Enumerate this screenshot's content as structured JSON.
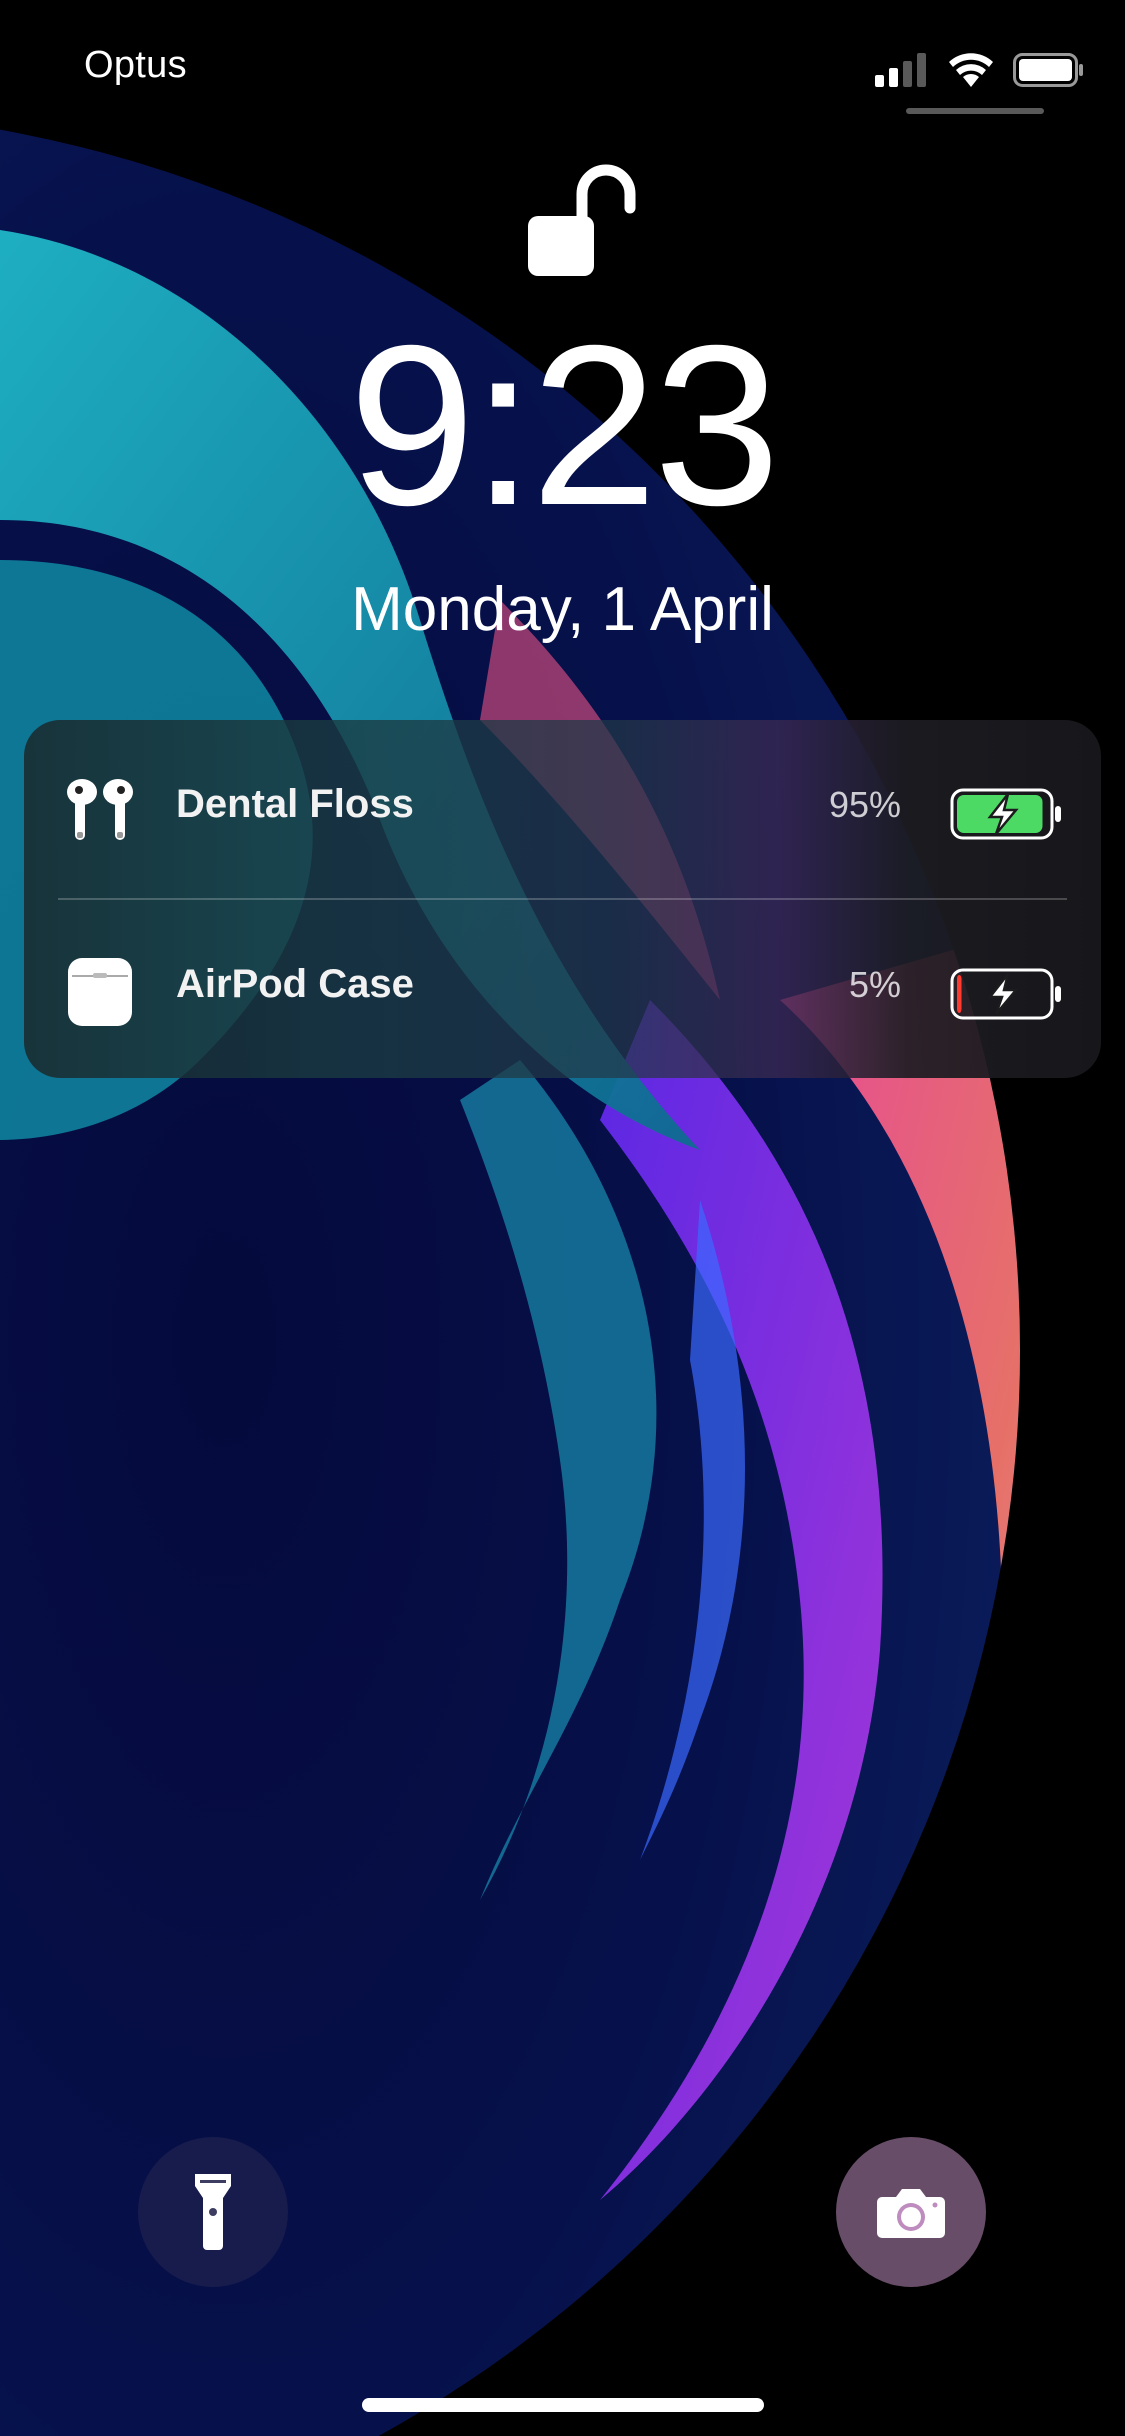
{
  "status_bar": {
    "carrier": "Optus",
    "icons": [
      "cellular-signal-icon",
      "wifi-icon",
      "battery-icon"
    ]
  },
  "lock_screen": {
    "lock_state_icon": "unlocked-padlock-icon",
    "time": "9:23",
    "date": "Monday, 1 April"
  },
  "battery_widget": {
    "devices": [
      {
        "name": "Dental Floss",
        "percent_label": "95%",
        "level": 0.95,
        "charging": true,
        "icon": "airpods-icon",
        "bar_color": "#4cd964"
      },
      {
        "name": "AirPod Case",
        "percent_label": "5%",
        "level": 0.05,
        "charging": true,
        "icon": "airpods-case-icon",
        "bar_color": "#ff3b30"
      }
    ]
  },
  "bottom_buttons": {
    "left": "flashlight-icon",
    "right": "camera-icon"
  }
}
